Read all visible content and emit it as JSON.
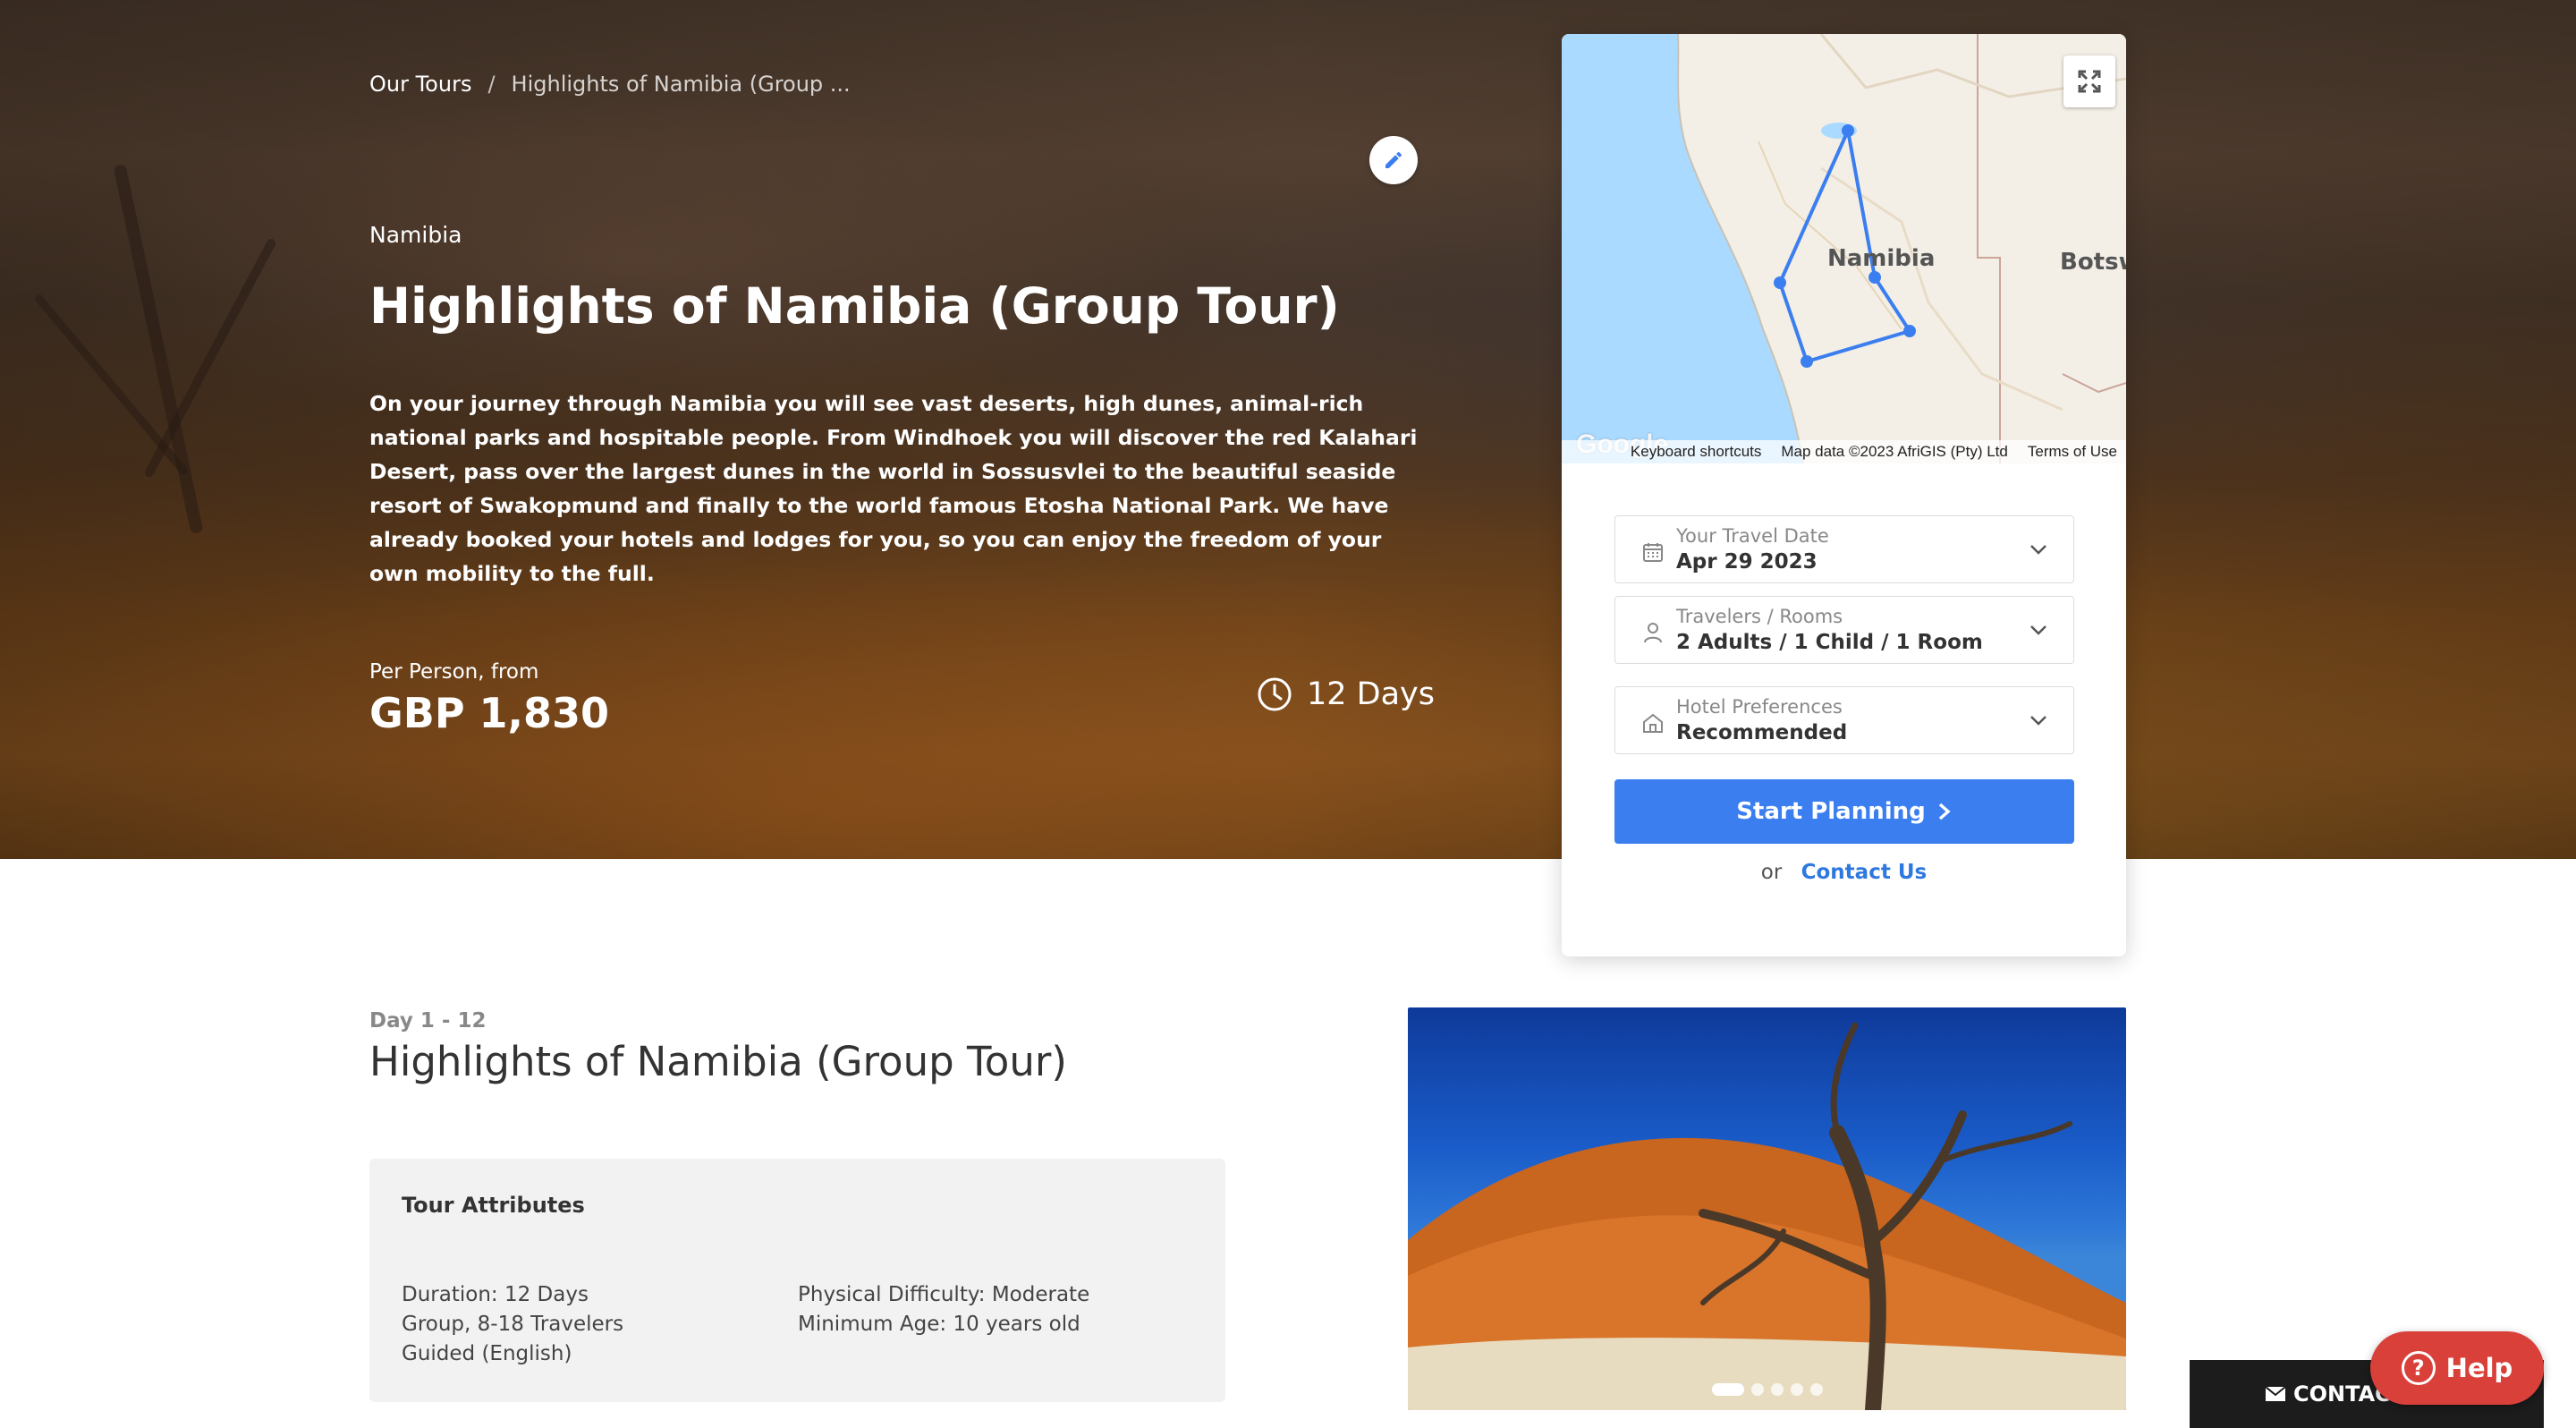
{
  "breadcrumb": {
    "parent": "Our Tours",
    "separator": "/",
    "current": "Highlights of Namibia (Group ..."
  },
  "hero": {
    "region": "Namibia",
    "title": "Highlights of Namibia (Group Tour)",
    "description": "On your journey through Namibia you will see vast deserts, high dunes, animal-rich national parks and hospitable people. From Windhoek you will discover the red Kalahari Desert, pass over the largest dunes in the world in Sossusvlei to the beautiful seaside resort of Swakopmund and finally to the world famous Etosha National Park. We have already booked your hotels and lodges for you, so you can enjoy the freedom of your own mobility to the full.",
    "price_label": "Per Person, from",
    "price": "GBP 1,830",
    "duration": "12 Days",
    "edit_icon": "pencil-icon",
    "duration_icon": "clock-icon"
  },
  "map": {
    "country_label": "Namibia",
    "neighbor_label": "Botsw",
    "google_logo": "Google",
    "footer": {
      "shortcuts": "Keyboard shortcuts",
      "map_data": "Map data ©2023 AfriGIS (Pty) Ltd",
      "terms": "Terms of Use"
    },
    "fullscreen_icon": "expand-icon",
    "route_color": "#3b7ef0",
    "water_color": "#aadaff"
  },
  "booking": {
    "travel_date": {
      "label": "Your Travel Date",
      "value": "Apr 29 2023",
      "icon": "calendar-icon"
    },
    "travelers": {
      "label": "Travelers / Rooms",
      "value": "2 Adults / 1 Child / 1 Room",
      "icon": "person-icon"
    },
    "hotel": {
      "label": "Hotel Preferences",
      "value": "Recommended",
      "icon": "hotel-icon"
    },
    "start_button": "Start Planning",
    "or_text": "or",
    "contact_link": "Contact Us",
    "accent_color": "#3b7ef0"
  },
  "itinerary": {
    "day_range": "Day 1 - 12",
    "title": "Highlights of Namibia (Group Tour)",
    "attributes_title": "Tour Attributes",
    "attributes_left": [
      "Duration: 12 Days",
      "Group, 8-18 Travelers",
      "Guided (English)"
    ],
    "attributes_right": [
      "Physical Difficulty: Moderate",
      "Minimum Age: 10 years old"
    ]
  },
  "gallery": {
    "dot_count": 5,
    "active_index": 0
  },
  "widgets": {
    "contact_label": "CONTACT US",
    "help_label": "Help",
    "help_color": "#d9403a"
  }
}
